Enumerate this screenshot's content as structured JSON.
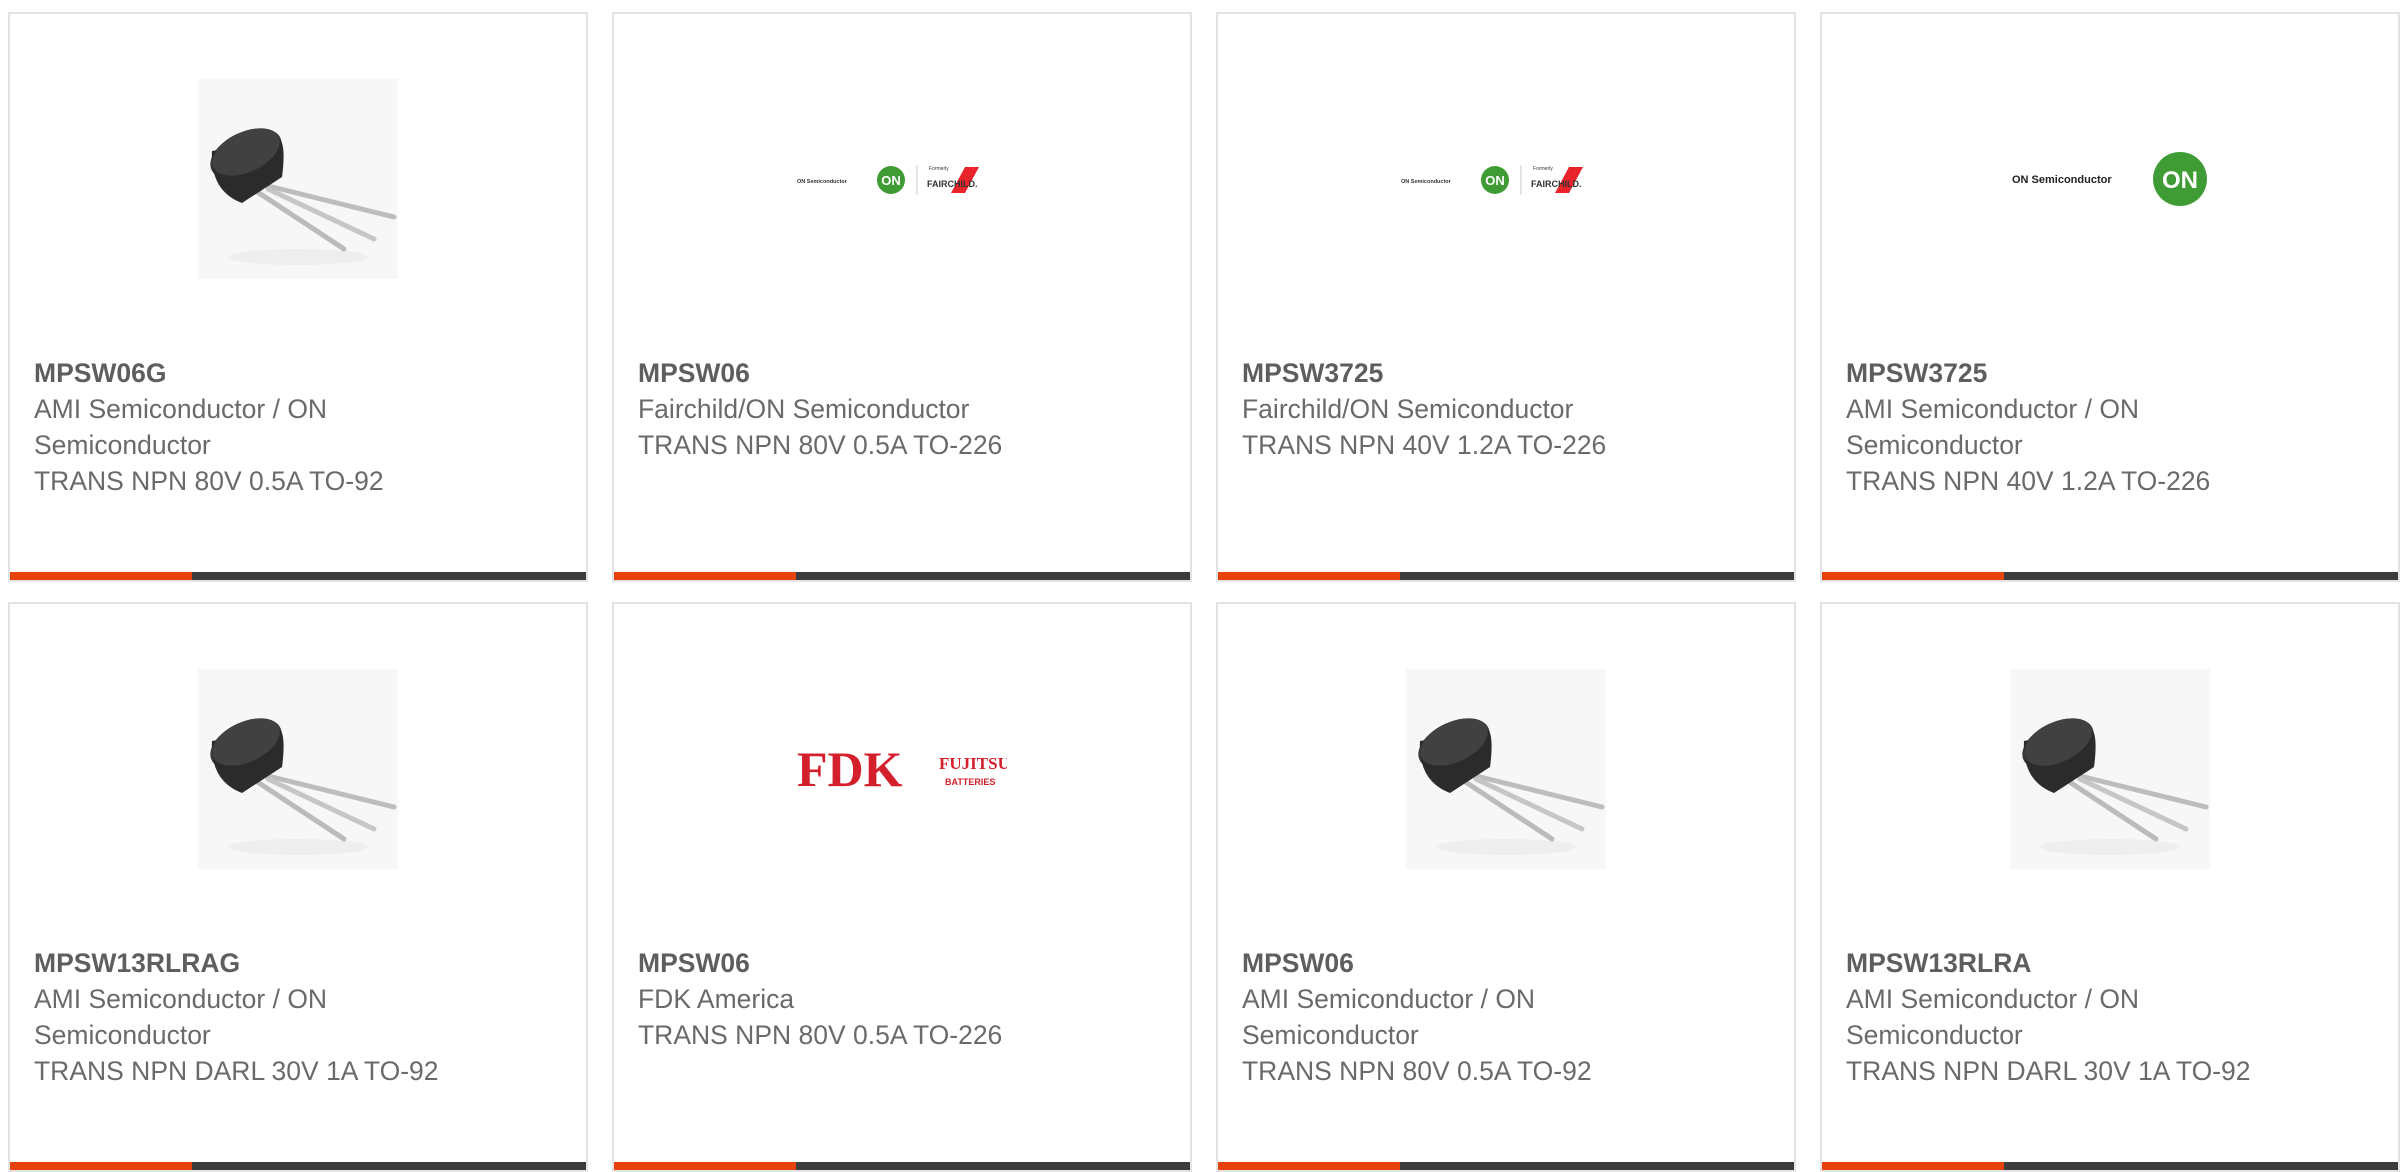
{
  "colors": {
    "accent": "#e8420c",
    "bar": "#3c3c3c",
    "text": "#6a6a6a",
    "border": "#e3e3e3",
    "on_green": "#3f9c35",
    "fairchild_red": "#e8232a",
    "fdk_red": "#d4202c"
  },
  "products": [
    {
      "part_number": "MPSW06G",
      "manufacturer": "AMI Semiconductor / ON Semiconductor",
      "description": "TRANS NPN 80V 0.5A TO-92",
      "image": "to-92-transistor-photo"
    },
    {
      "part_number": "MPSW06",
      "manufacturer": "Fairchild/ON Semiconductor",
      "description": "TRANS NPN 80V 0.5A TO-226",
      "image": "on-fairchild-logo",
      "logo_text": {
        "on_semi": "ON Semiconductor",
        "on": "ON",
        "formerly": "Formerly",
        "fairchild": "FAIRCHILD."
      }
    },
    {
      "part_number": "MPSW3725",
      "manufacturer": "Fairchild/ON Semiconductor",
      "description": "TRANS NPN 40V 1.2A TO-226",
      "image": "on-fairchild-logo",
      "logo_text": {
        "on_semi": "ON Semiconductor",
        "on": "ON",
        "formerly": "Formerly",
        "fairchild": "FAIRCHILD."
      }
    },
    {
      "part_number": "MPSW3725",
      "manufacturer": "AMI Semiconductor / ON Semiconductor",
      "description": "TRANS NPN 40V 1.2A TO-226",
      "image": "on-semiconductor-logo",
      "logo_text": {
        "on_semi": "ON Semiconductor",
        "on": "ON"
      }
    },
    {
      "part_number": "MPSW13RLRAG",
      "manufacturer": "AMI Semiconductor / ON Semiconductor",
      "description": "TRANS NPN DARL 30V 1A TO-92",
      "image": "to-92-transistor-photo"
    },
    {
      "part_number": "MPSW06",
      "manufacturer": "FDK America",
      "description": "TRANS NPN 80V 0.5A TO-226",
      "image": "fdk-fujitsu-logo",
      "logo_text": {
        "fdk": "FDK",
        "fujitsu": "FUJITSU",
        "batteries": "BATTERIES"
      }
    },
    {
      "part_number": "MPSW06",
      "manufacturer": "AMI Semiconductor / ON Semiconductor",
      "description": "TRANS NPN 80V 0.5A TO-92",
      "image": "to-92-transistor-photo"
    },
    {
      "part_number": "MPSW13RLRA",
      "manufacturer": "AMI Semiconductor / ON Semiconductor",
      "description": "TRANS NPN DARL 30V 1A TO-92",
      "image": "to-92-transistor-photo"
    }
  ]
}
